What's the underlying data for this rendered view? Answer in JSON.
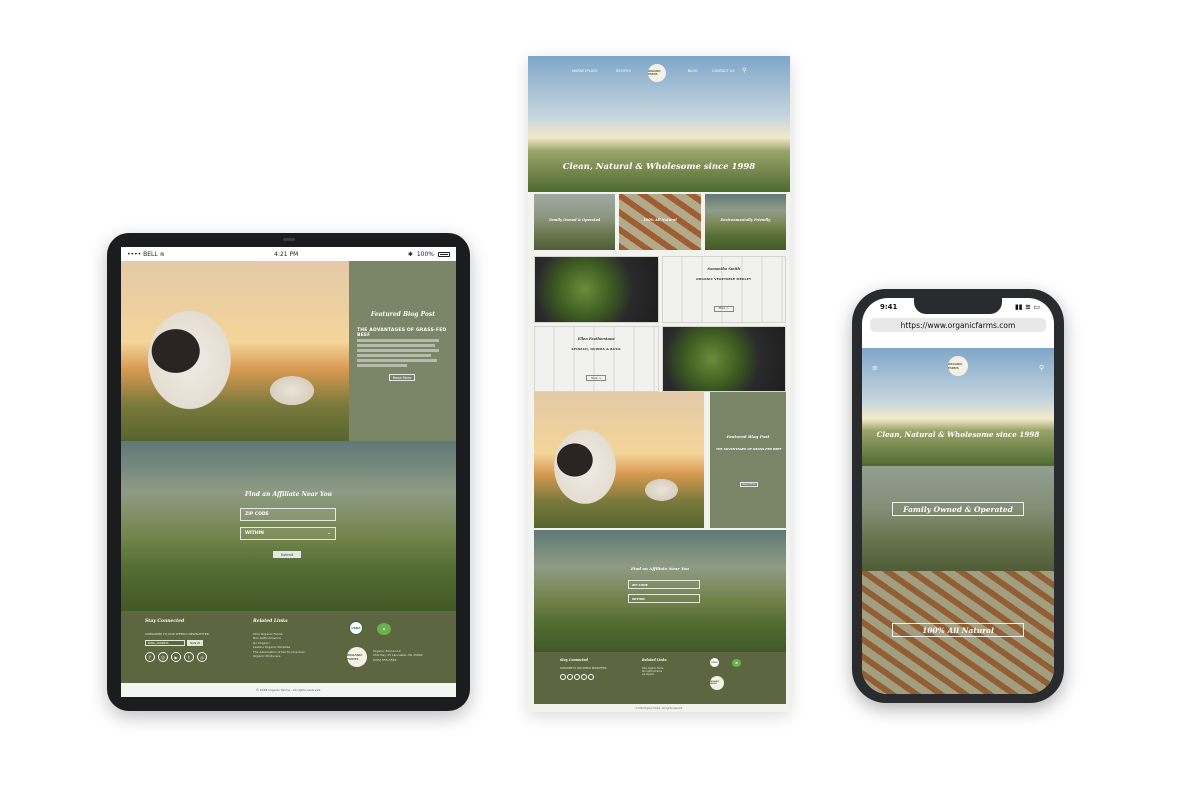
{
  "tablet": {
    "status": {
      "carrier": "BELL",
      "time": "4:21 PM",
      "battery": "100%"
    },
    "featured": {
      "label": "Featured Blog Post",
      "headline": "THE ADVANTAGES OF GRASS-FED BEEF",
      "button": "Read More"
    },
    "affiliate": {
      "title": "Find an Affiliate Near You",
      "zip_placeholder": "ZIP CODE",
      "within": "WITHIN",
      "submit": "Submit"
    },
    "footer": {
      "stay_connected": "Stay Connected",
      "newsletter": "SUBSCRIBE TO OUR WEEKLY NEWSLETTER.",
      "email_placeholder": "EMAIL ADDRESS",
      "signup": "SIGN UP",
      "related_links": "Related Links",
      "links": [
        "Ohio Organic Farms",
        "Non-GMO America",
        "Go Organic",
        "Leslie's Organic Paradise",
        "The Association of North American",
        "Organic Producers"
      ],
      "company": "Organic Farms LLC.",
      "address": "156 Hwy 33 Lancaster, PA 15802",
      "phone": "(555) 555-5555",
      "copyright": "© 2018 Organic Farms . All rights reserved."
    },
    "logo_text": "ORGANIC FARMS"
  },
  "longpage": {
    "nav": {
      "marketplace": "MARKETPLACE",
      "recipes": "RECIPES",
      "logo": "ORGANIC FARMS",
      "blog": "BLOG",
      "contact": "CONTACT US"
    },
    "hero_title": "Clean, Natural & Wholesome since 1998",
    "tiles": [
      "Family Owned & Operated",
      "100% All Natural",
      "Environmentally Friendly"
    ],
    "cards": [
      {
        "author": "Samantha Smith",
        "headline": "ORGANIC VEGETABLE MEDLEY",
        "more": "More ->"
      },
      {
        "author": "Ellen Featherstone",
        "headline": "SPINACH, QUINOA & BASIL",
        "more": "More ->"
      }
    ],
    "featured": {
      "label": "Featured Blog Post",
      "headline": "THE ADVANTAGES OF GRASS-FED BEEF",
      "button": "Read More"
    },
    "affiliate": {
      "title": "Find an Affiliate Near You",
      "zip": "ZIP CODE",
      "within": "WITHIN"
    },
    "footer": {
      "stay_connected": "Stay Connected",
      "related_links": "Related Links"
    }
  },
  "phone": {
    "status_time": "9:41",
    "url": "https://www.organicfarms.com",
    "logo": "ORGANIC FARMS",
    "hero_title": "Clean, Natural & Wholesome since 1998",
    "family": "Family Owned & Operated",
    "natural": "100% All Natural"
  }
}
